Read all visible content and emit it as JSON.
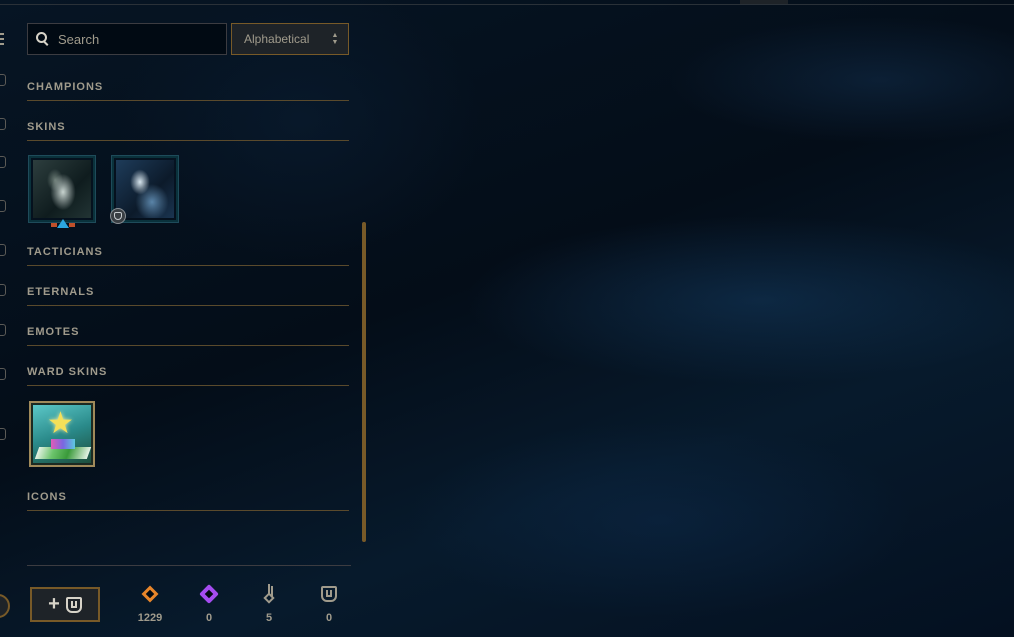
{
  "search": {
    "placeholder": "Search",
    "icon": "search-icon"
  },
  "sort": {
    "selected": "Alphabetical",
    "icon": "sort-arrows-icon"
  },
  "categories": [
    {
      "label": "CHAMPIONS"
    },
    {
      "label": "SKINS"
    },
    {
      "label": "TACTICIANS"
    },
    {
      "label": "ETERNALS"
    },
    {
      "label": "EMOTES"
    },
    {
      "label": "WARD SKINS"
    },
    {
      "label": "ICONS"
    }
  ],
  "skins": [
    {
      "icon": "skin-portrait-icon",
      "badge": "rarity-gem-icon"
    },
    {
      "icon": "skin-portrait-icon",
      "badge": "chroma-icon"
    }
  ],
  "ward_skins": [
    {
      "icon": "star-ward-icon"
    }
  ],
  "footer": {
    "add_button_icon": "add-ward-icon",
    "currencies": [
      {
        "icon": "blue-essence-icon",
        "value": "1229",
        "color": "#e8862a"
      },
      {
        "icon": "mythic-essence-icon",
        "value": "0",
        "color": "#a54cf0"
      },
      {
        "icon": "key-icon",
        "value": "5",
        "color": "#a09b8c"
      },
      {
        "icon": "ward-token-icon",
        "value": "0",
        "color": "#a09b8c"
      }
    ]
  },
  "colors": {
    "gold_accent": "#785a28",
    "text": "#a09b8c",
    "background": "#030a12"
  }
}
